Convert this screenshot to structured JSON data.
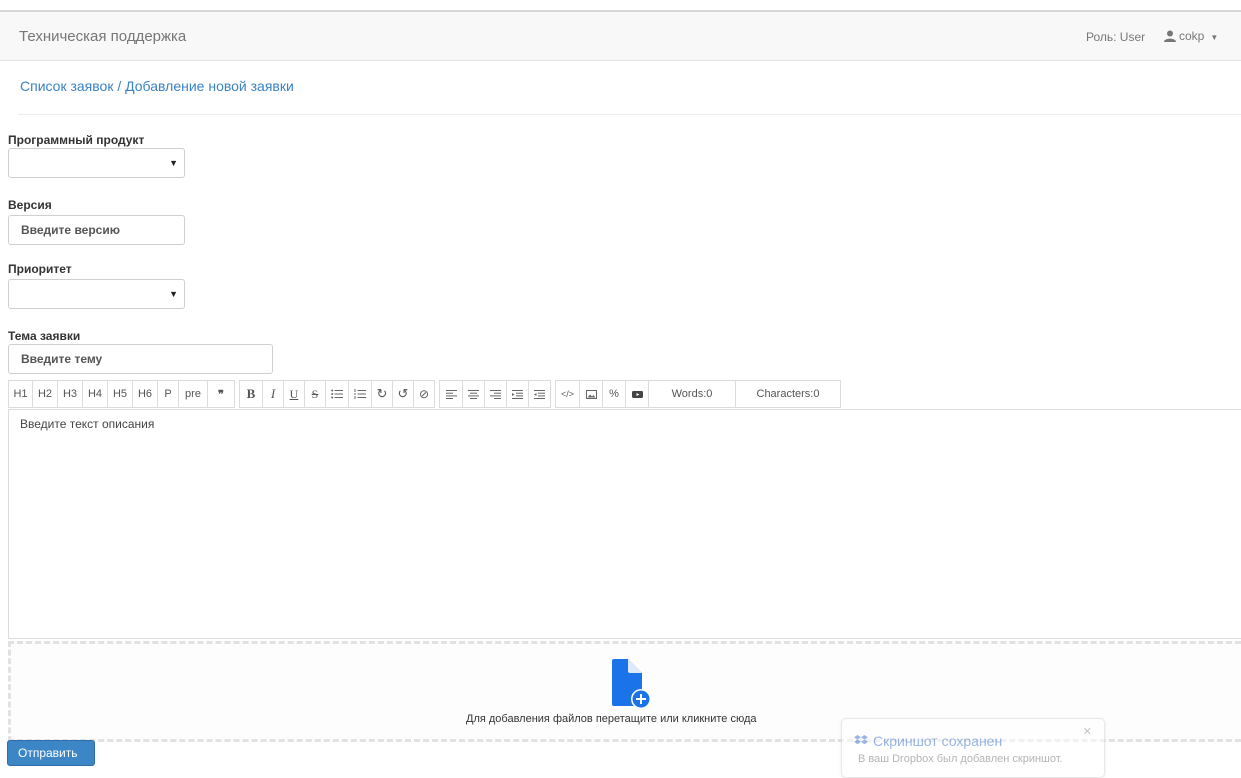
{
  "header": {
    "brand": "Техническая поддержка",
    "role": "Роль: User",
    "user": "cokp"
  },
  "breadcrumb": {
    "list": "Список заявок",
    "separator": " / ",
    "current": "Добавление новой заявки"
  },
  "form": {
    "product_label": "Программный продукт",
    "product_value": "",
    "version_label": "Версия",
    "version_placeholder": "Введите версию",
    "priority_label": "Приоритет",
    "priority_value": "",
    "subject_label": "Тема заявки",
    "subject_placeholder": "Введите тему"
  },
  "toolbar": {
    "headings": [
      "H1",
      "H2",
      "H3",
      "H4",
      "H5",
      "H6",
      "P",
      "pre",
      "❞"
    ],
    "words": "Words:0",
    "characters": "Characters:0"
  },
  "editor": {
    "placeholder": "Введите текст описания"
  },
  "dropzone": {
    "text": "Для добавления файлов перетащите или кликните сюда"
  },
  "submit_label": "Отправить",
  "toast": {
    "title": "Скриншот сохранен",
    "body": "В ваш Dropbox был добавлен скриншот."
  },
  "colors": {
    "link": "#3a83c4",
    "primary_button": "#3c86c6",
    "upload_icon": "#1a73e8"
  }
}
